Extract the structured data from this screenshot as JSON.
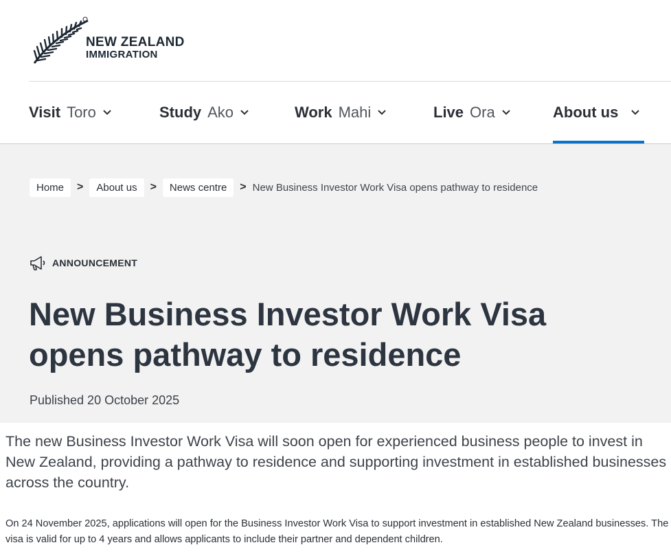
{
  "logo": {
    "line1": "NEW ZEALAND",
    "line2": "IMMIGRATION",
    "icon": "silver-fern-icon"
  },
  "nav": {
    "items": [
      {
        "en": "Visit",
        "mi": "Toro"
      },
      {
        "en": "Study",
        "mi": "Ako"
      },
      {
        "en": "Work",
        "mi": "Mahi"
      },
      {
        "en": "Live",
        "mi": "Ora"
      },
      {
        "en": "About us",
        "mi": ""
      }
    ],
    "active_index": 4,
    "accent_color": "#0a73c7"
  },
  "breadcrumb": {
    "items": [
      "Home",
      "About us",
      "News centre"
    ],
    "separator": ">",
    "current": "New Business Investor Work Visa opens pathway to residence"
  },
  "article": {
    "category": "ANNOUNCEMENT",
    "category_icon": "megaphone-icon",
    "title_line1": "New Business Investor Work Visa",
    "title_line2": "opens pathway to residence",
    "published": "Published 20 October 2025",
    "lead": "The new Business Investor Work Visa will soon open for experienced business people to invest in New Zealand, providing a pathway to residence and supporting investment in established businesses across the country.",
    "paragraph": "On 24 November 2025, applications will open for the Business Investor Work Visa to support investment in established New Zealand businesses. The visa is valid for up to 4 years and allows applicants to include their partner and dependent children."
  },
  "colors": {
    "hero_background": "#f2f2f2",
    "heading": "#2d3540"
  }
}
